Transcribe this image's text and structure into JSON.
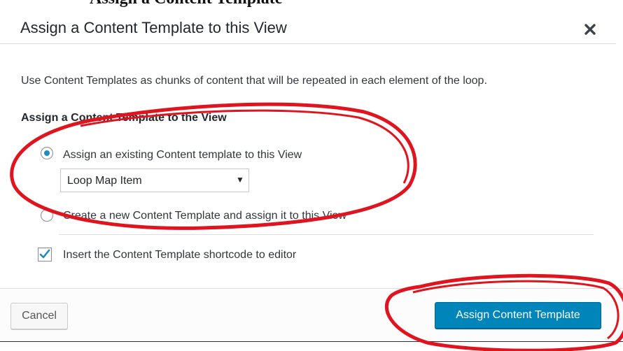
{
  "page_heading_cut": "Assign a Content Template",
  "dialog": {
    "title": "Assign a Content Template to this View",
    "close_icon": "close-icon",
    "description": "Use Content Templates as chunks of content that will be repeated in each element of the loop.",
    "section_heading": "Assign a Content Template to the View",
    "options": [
      {
        "label": "Assign an existing Content template to this View",
        "selected": true
      },
      {
        "label": "Create a new Content Template and assign it to this View",
        "selected": false
      }
    ],
    "template_select": {
      "value": "Loop Map Item",
      "caret": "▼"
    },
    "checkbox": {
      "label": "Insert the Content Template shortcode to editor",
      "checked": true
    }
  },
  "footer": {
    "cancel_label": "Cancel",
    "assign_label": "Assign Content Template"
  },
  "colors": {
    "primary_button": "#0085ba",
    "radio_selected": "#1e8cbe",
    "annotation_red": "#e0141e"
  }
}
